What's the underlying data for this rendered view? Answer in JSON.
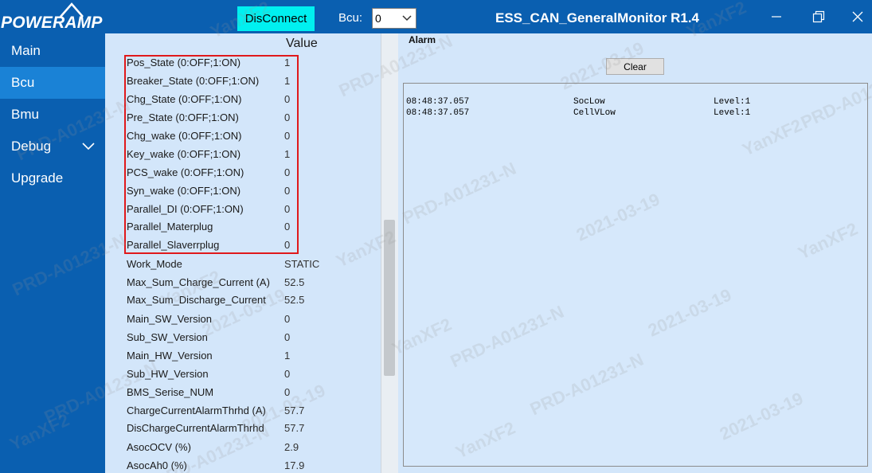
{
  "window": {
    "brand": "POWERAMP",
    "title": "ESS_CAN_GeneralMonitor R1.4",
    "disconnect_label": "DisConnect",
    "bcu_label": "Bcu:",
    "bcu_selected": "0"
  },
  "nav": {
    "items": [
      {
        "label": "Main"
      },
      {
        "label": "Bcu"
      },
      {
        "label": "Bmu"
      },
      {
        "label": "Debug"
      },
      {
        "label": "Upgrade"
      }
    ]
  },
  "params": {
    "value_header": "Value",
    "rows": [
      {
        "name": "Pos_State  (0:OFF;1:ON)",
        "value": "1"
      },
      {
        "name": "Breaker_State (0:OFF;1:ON)",
        "value": "1"
      },
      {
        "name": "Chg_State (0:OFF;1:ON)",
        "value": "0"
      },
      {
        "name": "Pre_State (0:OFF;1:ON)",
        "value": "0"
      },
      {
        "name": "Chg_wake (0:OFF;1:ON)",
        "value": "0"
      },
      {
        "name": "Key_wake (0:OFF;1:ON)",
        "value": "1"
      },
      {
        "name": "PCS_wake (0:OFF;1:ON)",
        "value": "0"
      },
      {
        "name": "Syn_wake (0:OFF;1:ON)",
        "value": "0"
      },
      {
        "name": "Parallel_DI (0:OFF;1:ON)",
        "value": "0"
      },
      {
        "name": "Parallel_Materplug",
        "value": "0"
      },
      {
        "name": "Parallel_Slaverrplug",
        "value": "0"
      },
      {
        "name": "Work_Mode",
        "value": "STATIC"
      },
      {
        "name": "Max_Sum_Charge_Current (A)",
        "value": "52.5"
      },
      {
        "name": "Max_Sum_Discharge_Current",
        "value": "52.5"
      },
      {
        "name": "Main_SW_Version",
        "value": "0"
      },
      {
        "name": "Sub_SW_Version",
        "value": "0"
      },
      {
        "name": "Main_HW_Version",
        "value": "1"
      },
      {
        "name": "Sub_HW_Version",
        "value": "0"
      },
      {
        "name": "BMS_Serise_NUM",
        "value": "0"
      },
      {
        "name": "ChargeCurrentAlarmThrhd (A)",
        "value": "57.7"
      },
      {
        "name": "DisChargeCurrentAlarmThrhd",
        "value": "57.7"
      },
      {
        "name": "AsocOCV (%)",
        "value": "2.9"
      },
      {
        "name": "AsocAh0 (%)",
        "value": "17.9"
      }
    ]
  },
  "alarm": {
    "title": "Alarm",
    "clear_label": "Clear",
    "entries": [
      {
        "time": "08:48:37.057",
        "type": "SocLow",
        "level": "Level:1"
      },
      {
        "time": "08:48:37.057",
        "type": "CellVLow",
        "level": "Level:1"
      }
    ]
  },
  "watermark": {
    "user": "YanXF2",
    "code": "PRD-A01231-N",
    "date": "2021-03-19"
  },
  "colors": {
    "titlebar": "#0a5fb0",
    "nav_active": "#1a82d6",
    "panel_bg": "#d3e6fa",
    "disconnect_bg": "#00f0f0",
    "highlight_border": "#e0191b"
  }
}
